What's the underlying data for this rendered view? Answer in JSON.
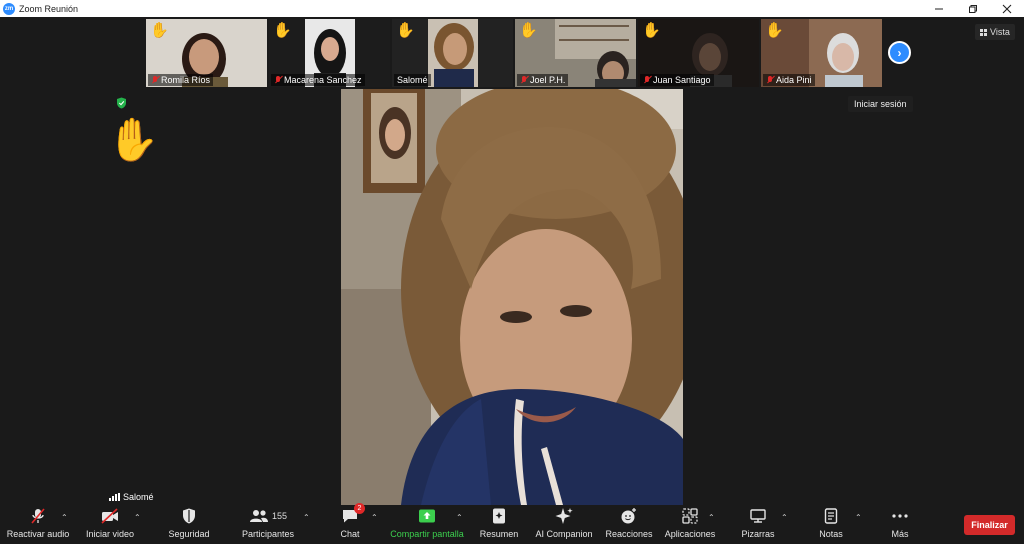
{
  "window": {
    "title": "Zoom Reunión",
    "logo_text": "zm"
  },
  "strip": {
    "participants": [
      {
        "name": "Romila  Ríos",
        "hand": "✋",
        "muted": true
      },
      {
        "name": "Macarena Sanchez",
        "hand": "✋",
        "muted": true
      },
      {
        "name": "Salomé",
        "hand": "✋",
        "muted": false
      },
      {
        "name": "Joel P.H.",
        "hand": "✋",
        "muted": true
      },
      {
        "name": "Juan Santiago",
        "hand": "✋",
        "muted": true
      },
      {
        "name": "Aida Pini",
        "hand": "✋",
        "muted": true
      }
    ]
  },
  "view_button": "Vista",
  "signin_tooltip": "Iniciar sesión",
  "raised_hand": "✋",
  "speaker_name": "Salomé",
  "toolbar": {
    "audio": "Reactivar audio",
    "video": "Iniciar video",
    "security": "Seguridad",
    "participants": "Participantes",
    "participants_count": "155",
    "chat": "Chat",
    "chat_badge": "2",
    "share": "Compartir pantalla",
    "summary": "Resumen",
    "companion": "AI Companion",
    "reactions": "Reacciones",
    "apps": "Aplicaciones",
    "whiteboards": "Pizarras",
    "notes": "Notas",
    "more": "Más",
    "end": "Finalizar"
  },
  "colors": {
    "accent": "#2d8cff",
    "danger": "#d32a2a",
    "share_green": "#3ccf4e",
    "background": "#1a1a1a"
  }
}
